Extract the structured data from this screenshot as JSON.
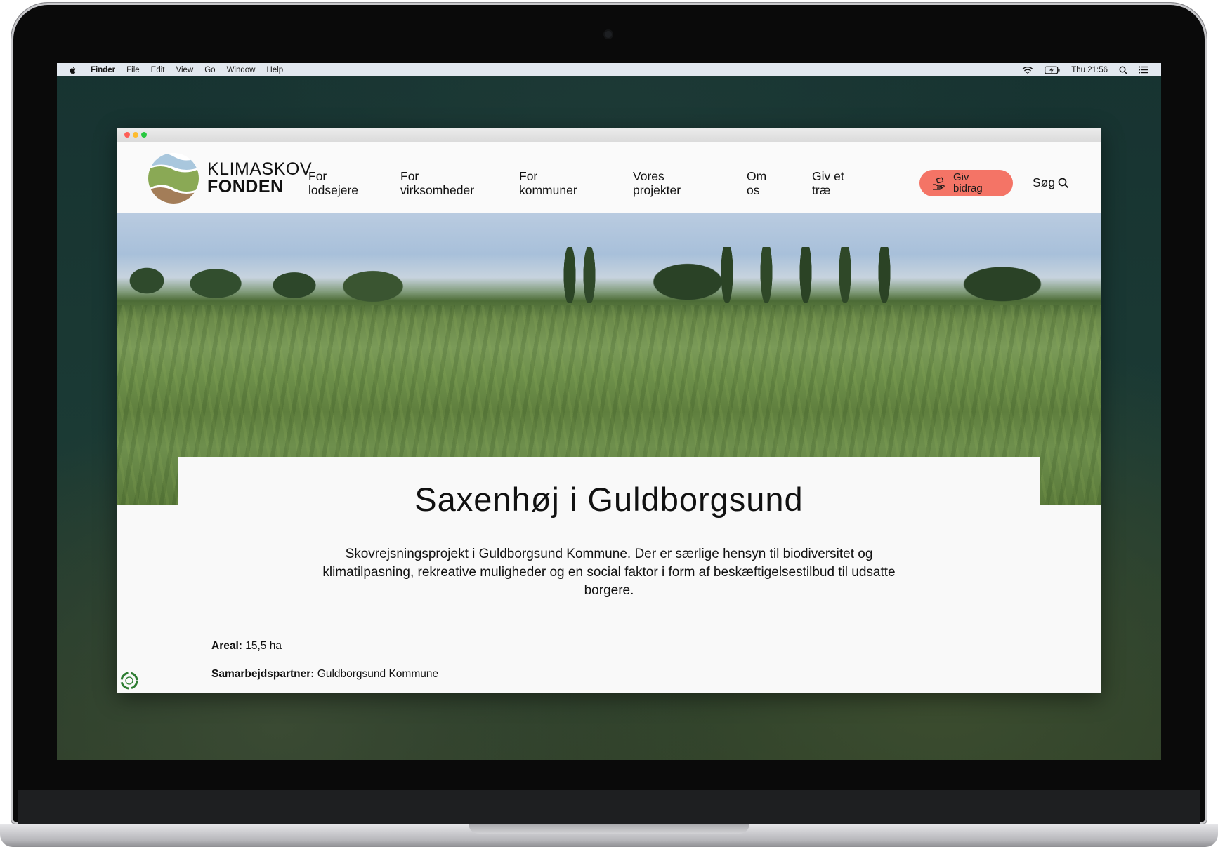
{
  "os_menubar": {
    "app_name": "Finder",
    "items": [
      "File",
      "Edit",
      "View",
      "Go",
      "Window",
      "Help"
    ],
    "clock": "Thu 21:56"
  },
  "site": {
    "logo": {
      "line1": "KLIMASKOV",
      "line2": "FONDEN"
    },
    "nav": [
      {
        "label": "For\nlodsejere"
      },
      {
        "label": "For\nvirksomheder"
      },
      {
        "label": "For\nkommuner"
      },
      {
        "label": "Vores\nprojekter"
      },
      {
        "label": "Om\nos"
      },
      {
        "label": "Giv et\ntræ"
      }
    ],
    "donate_label": "Giv\nbidrag",
    "search_label": "Søg"
  },
  "page": {
    "title": "Saxenhøj i Guldborgsund",
    "intro": "Skovrejsningsprojekt i Guldborgsund Kommune. Der er særlige hensyn til biodiversitet og klimatilpasning, rekreative muligheder og en social faktor i form af beskæftigelsestilbud til udsatte borgere.",
    "facts": [
      {
        "label": "Areal:",
        "value": "15,5 ha"
      },
      {
        "label": "Samarbejdspartner:",
        "value": "Guldborgsund Kommune"
      }
    ]
  },
  "colors": {
    "accent_donate": "#f47466",
    "logo_green": "#8aa955",
    "logo_blue": "#a9c7dd",
    "logo_brown": "#a37d58"
  }
}
